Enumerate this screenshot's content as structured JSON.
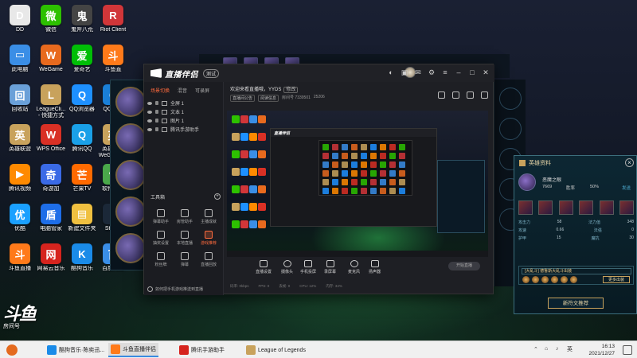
{
  "desktop_icons": [
    {
      "label": "DD",
      "color": "#e8e8e8",
      "glyph": "D"
    },
    {
      "label": "微信",
      "color": "#2dc100",
      "glyph": "微"
    },
    {
      "label": "鬼斧八荒",
      "color": "#444",
      "glyph": "鬼"
    },
    {
      "label": "Riot Client",
      "color": "#d13639",
      "glyph": "R"
    },
    {
      "label": "此电脑",
      "color": "#3a8ee6",
      "glyph": "▭"
    },
    {
      "label": "WeGame",
      "color": "#e86a1e",
      "glyph": "W"
    },
    {
      "label": "爱奇艺",
      "color": "#00be06",
      "glyph": "爱"
    },
    {
      "label": "斗鱼直",
      "color": "#ff7a1a",
      "glyph": "斗"
    },
    {
      "label": "回收站",
      "color": "#6aa0d8",
      "glyph": "回"
    },
    {
      "label": "LeagueCli...\n- 快捷方式",
      "color": "#c8a25c",
      "glyph": "L"
    },
    {
      "label": "QQ浏览器",
      "color": "#1e90ff",
      "glyph": "Q"
    },
    {
      "label": "QQ游戏",
      "color": "#1a7fd8",
      "glyph": "Q"
    },
    {
      "label": "英雄联盟",
      "color": "#c8a25c",
      "glyph": "英"
    },
    {
      "label": "WPS Office",
      "color": "#d93025",
      "glyph": "W"
    },
    {
      "label": "腾讯QQ",
      "color": "#1aa0e8",
      "glyph": "Q"
    },
    {
      "label": "英雄联盟\nWeGame版",
      "color": "#c8a25c",
      "glyph": "英"
    },
    {
      "label": "腾讯视频",
      "color": "#ff8a00",
      "glyph": "▶"
    },
    {
      "label": "奇游加",
      "color": "#3a6ae6",
      "glyph": "奇"
    },
    {
      "label": "芒果TV",
      "color": "#ff6a00",
      "glyph": "芒"
    },
    {
      "label": "软件管理",
      "color": "#4aa84a",
      "glyph": "✿"
    },
    {
      "label": "优酷",
      "color": "#1aa0ff",
      "glyph": "优"
    },
    {
      "label": "电脑管家",
      "color": "#1e6ee8",
      "glyph": "盾"
    },
    {
      "label": "新建文件夹",
      "color": "#f0c040",
      "glyph": "▤"
    },
    {
      "label": "Steam",
      "color": "#1b2838",
      "glyph": "S"
    },
    {
      "label": "斗鱼直播",
      "color": "#ff7a1a",
      "glyph": "斗"
    },
    {
      "label": "网易云音乐",
      "color": "#d6241e",
      "glyph": "网"
    },
    {
      "label": "酷狗音乐",
      "color": "#1a8be8",
      "glyph": "K"
    },
    {
      "label": "百度网盘",
      "color": "#3a8ee6",
      "glyph": "百"
    }
  ],
  "stream_app": {
    "brand": "直播伴侣",
    "version_badge": "测试",
    "left_tabs": [
      "场景切换",
      "混音",
      "可录屏"
    ],
    "scenes": [
      "全屏 1",
      "文本 1",
      "图片 1",
      "腾讯手游助手"
    ],
    "tools_title": "工具箱",
    "tools": [
      {
        "label": "弹幕助手",
        "active": false
      },
      {
        "label": "房管助手",
        "active": false
      },
      {
        "label": "主播成就",
        "active": false
      },
      {
        "label": "抽奖设置",
        "active": false
      },
      {
        "label": "本地直播",
        "active": false
      },
      {
        "label": "游戏推荐",
        "active": true
      },
      {
        "label": "粉丝牌",
        "active": false
      },
      {
        "label": "弹幕",
        "active": false
      },
      {
        "label": "直播回放",
        "active": false
      }
    ],
    "footer_text": "如何把手机游戏推送到直播",
    "room_title": "欢迎来看直播哦，YYDS",
    "room_tag": "修改",
    "room_meta": [
      "直播间公告",
      "阅读信息",
      "房间号 7339501",
      "25206"
    ],
    "controls": [
      {
        "label": "直播设置"
      },
      {
        "label": "摄像头"
      },
      {
        "label": "手机投屏"
      },
      {
        "label": "录屏幕"
      },
      {
        "label": "麦克风"
      },
      {
        "label": "扬声器"
      }
    ],
    "start_button": "开始直播",
    "status": [
      "码率: 0kbps",
      "FPS: 0",
      "丢帧: 0",
      "CPU: 12%",
      "内存: 34%"
    ]
  },
  "hero_panel": {
    "title": "英雄资料",
    "hero_name": "恶魔之眼",
    "games": "7669",
    "win_rate_label": "胜率",
    "win_rate": "50%",
    "share": "发送",
    "stats": [
      {
        "k": "攻击力",
        "v": "58",
        "k2": "法力值",
        "v2": "348"
      },
      {
        "k": "攻速",
        "v": "0.66",
        "k2": "法强",
        "v2": "0"
      },
      {
        "k": "护甲",
        "v": "15",
        "k2": "魔抗",
        "v2": "30"
      }
    ],
    "rune_select": "[大乱斗] 德鲁斯大乱斗出装",
    "more_button": "更多出装",
    "recommend_button": "新符文推荐"
  },
  "watermark": {
    "big": "斗鱼",
    "small": "房间号"
  },
  "taskbar": {
    "apps": [
      {
        "label": "酷狗音乐·陈奕迅...",
        "color": "#1a8be8",
        "active": false
      },
      {
        "label": "斗鱼直播伴侣",
        "color": "#ff7a1a",
        "active": true
      },
      {
        "label": "腾讯手游助手",
        "color": "#d6241e",
        "active": false
      },
      {
        "label": "League of Legends",
        "color": "#c8a25c",
        "active": false
      }
    ],
    "ime": "英",
    "time": "16:13",
    "date": "2021/12/27"
  }
}
